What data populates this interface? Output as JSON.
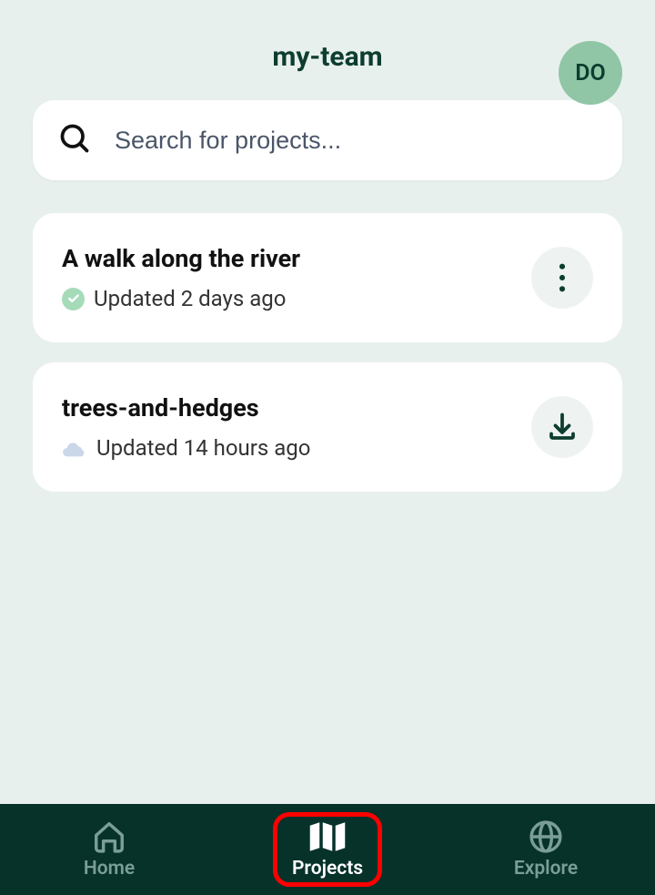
{
  "header": {
    "title": "my-team",
    "avatar_initials": "DO"
  },
  "search": {
    "placeholder": "Search for projects..."
  },
  "projects": [
    {
      "title": "A walk along the river",
      "updated": "Updated 2 days ago",
      "status": "synced",
      "action": "more"
    },
    {
      "title": "trees-and-hedges",
      "updated": "Updated 14 hours ago",
      "status": "cloud",
      "action": "download"
    }
  ],
  "nav": {
    "home": "Home",
    "projects": "Projects",
    "explore": "Explore",
    "active": "projects"
  }
}
